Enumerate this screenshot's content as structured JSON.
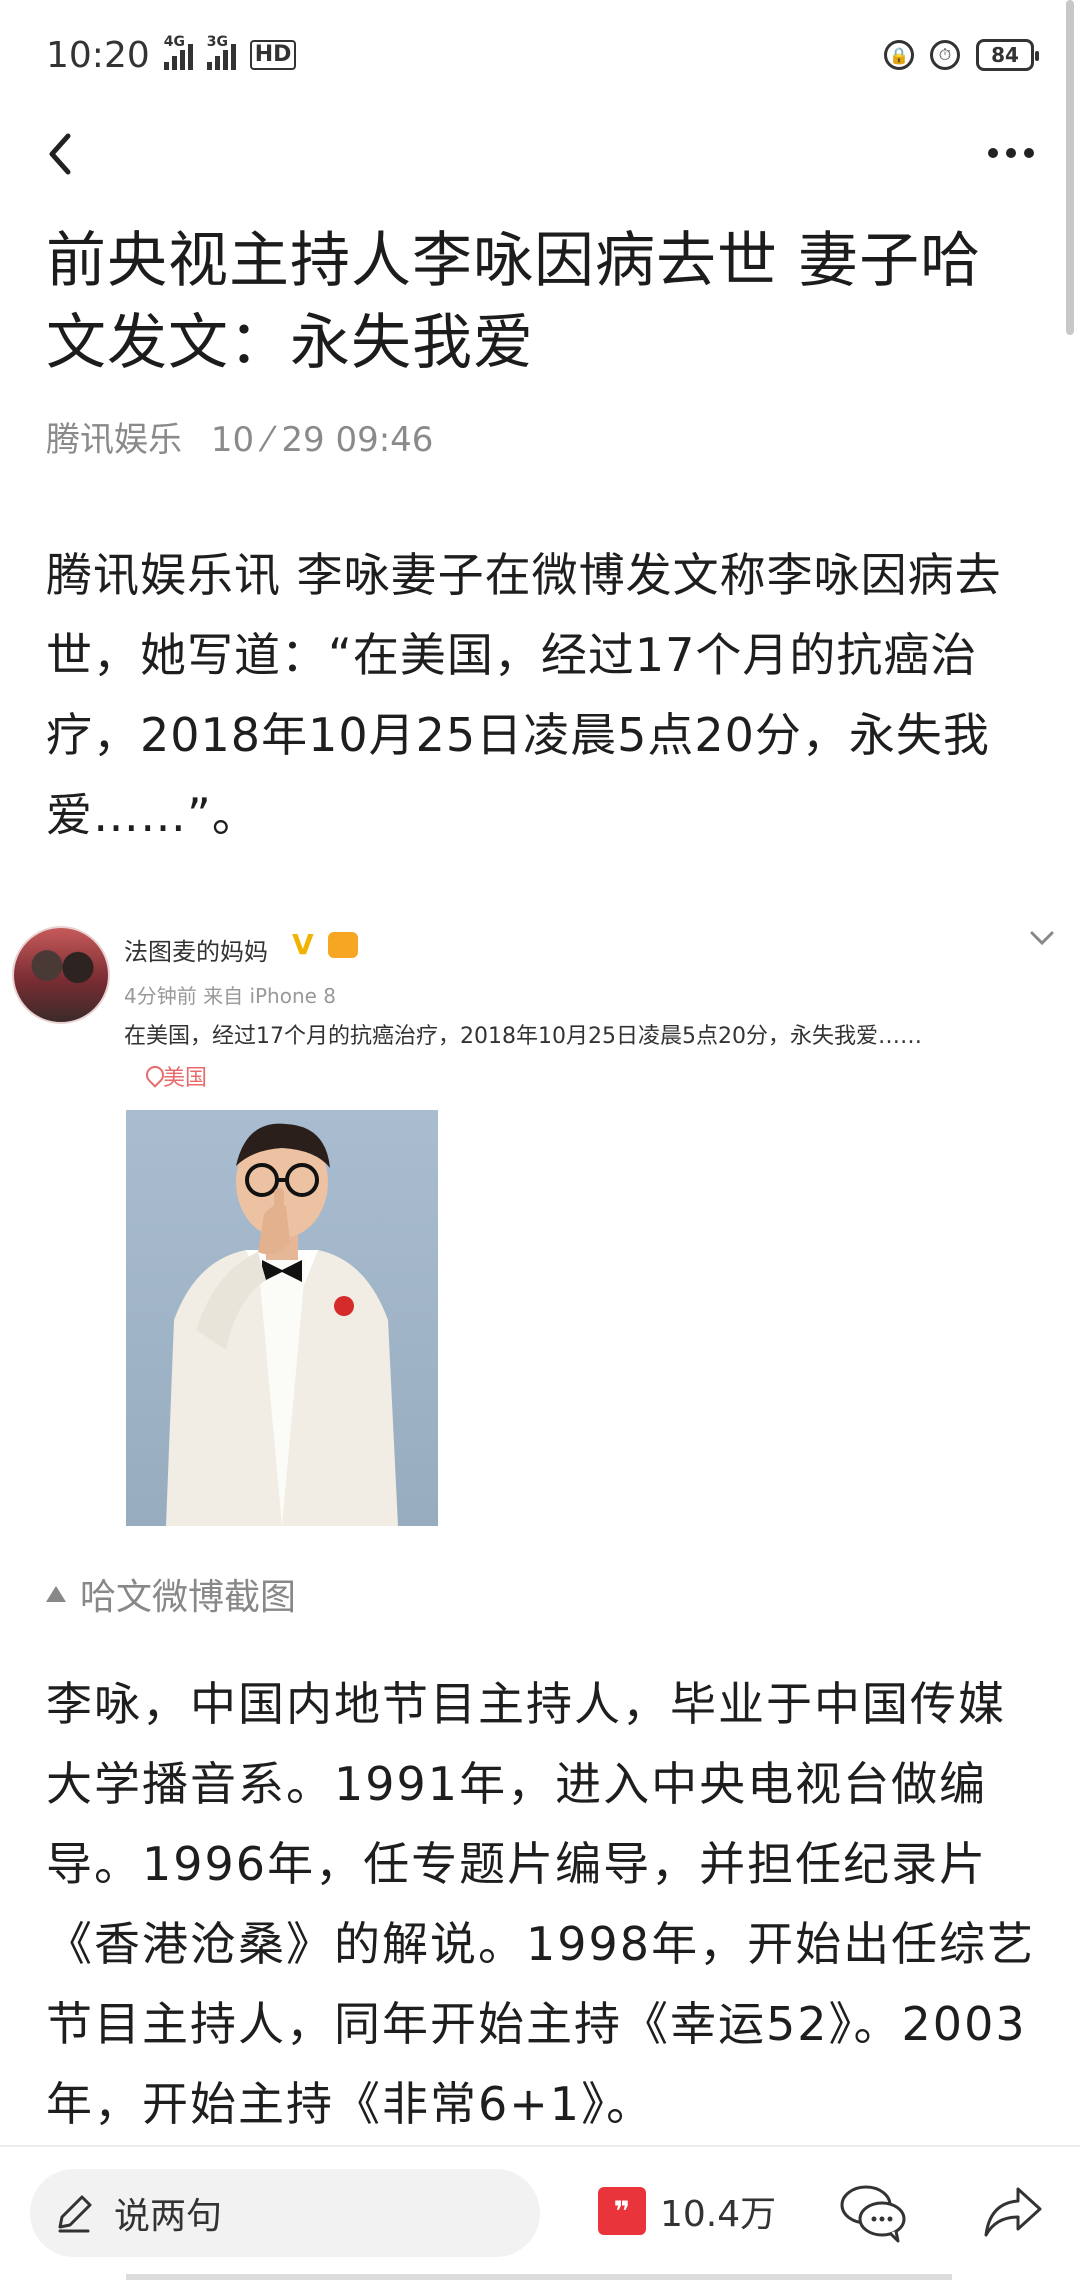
{
  "status_bar": {
    "time": "10:20",
    "signal1": "4G",
    "signal2": "3G",
    "hd": "HD",
    "battery": "84"
  },
  "article": {
    "title": "前央视主持人李咏因病去世 妻子哈文发文：永失我爱",
    "source": "腾讯娱乐",
    "date": "10 ⁄ 29 09:46",
    "para1": "腾讯娱乐讯 李咏妻子在微博发文称李咏因病去世，她写道：“在美国，经过17个月的抗癌治疗，2018年10月25日凌晨5点20分，永失我爱……”。",
    "image_caption": "哈文微博截图",
    "para2": "李咏，中国内地节目主持人，毕业于中国传媒大学播音系。1991年，进入中央电视台做编导。1996年，任专题片编导，并担任纪录片《香港沧桑》的解说。1998年，开始出任综艺节目主持人，同年开始主持《幸运52》。2003年，开始主持《非常6+1》。"
  },
  "weibo": {
    "name": "法图麦的妈妈",
    "time_source": "4分钟前 来自 iPhone 8",
    "text": "在美国，经过17个月的抗癌治疗，2018年10月25日凌晨5点20分，永失我爱……",
    "location": "美国"
  },
  "bottom_bar": {
    "comment_placeholder": "说两句",
    "like_count": "10.4万"
  }
}
